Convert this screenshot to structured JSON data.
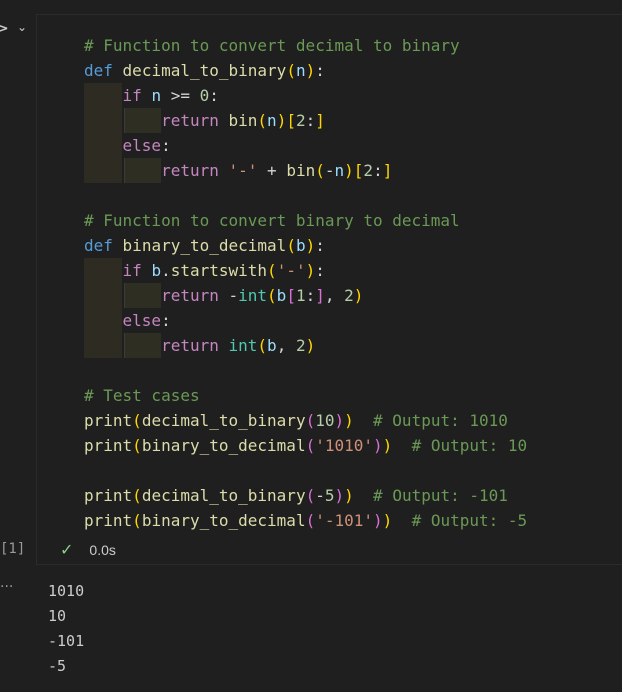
{
  "cell": {
    "execution_count": "[1]",
    "status_time": "0.0s",
    "code": {
      "line1": "# Function to convert decimal to binary",
      "line10": "# Function to convert binary to decimal",
      "line18": "# Test cases",
      "c_out1": "# Output: 1010",
      "c_out2": "# Output: 10",
      "c_out3": "# Output: -101",
      "c_out4": "# Output: -5"
    }
  },
  "output": {
    "lines": [
      "1010",
      "10",
      "-101",
      "-5"
    ]
  }
}
